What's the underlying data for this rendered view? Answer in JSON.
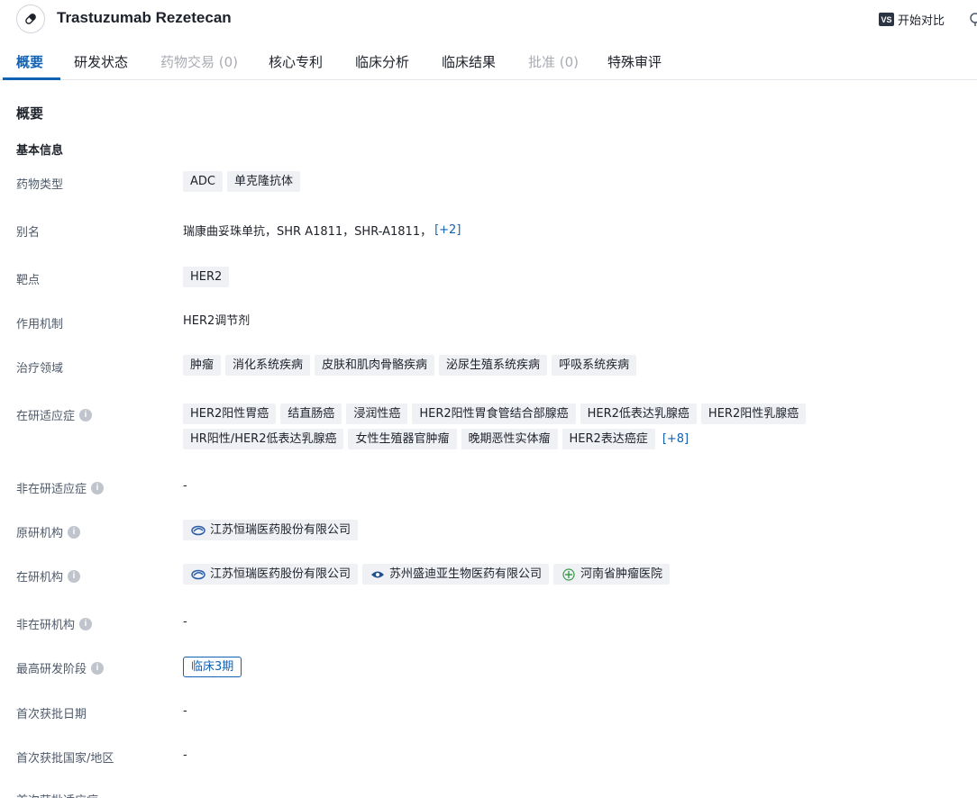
{
  "header": {
    "drug_name": "Trastuzumab Rezetecan",
    "drug_icon": "pill-icon",
    "compare_badge": "VS",
    "compare_label": "开始对比"
  },
  "tabs": [
    {
      "label": "概要",
      "state": "active"
    },
    {
      "label": "研发状态",
      "state": "normal"
    },
    {
      "label": "药物交易 (0)",
      "state": "disabled"
    },
    {
      "label": "核心专利",
      "state": "normal"
    },
    {
      "label": "临床分析",
      "state": "normal"
    },
    {
      "label": "临床结果",
      "state": "normal"
    },
    {
      "label": "批准 (0)",
      "state": "disabled"
    },
    {
      "label": "特殊审评",
      "state": "normal"
    }
  ],
  "overview": {
    "section_title": "概要",
    "basic_info_title": "基本信息"
  },
  "fields": {
    "drug_type": {
      "label": "药物类型",
      "tags": [
        "ADC",
        "单克隆抗体"
      ]
    },
    "alias": {
      "label": "别名",
      "text": "瑞康曲妥珠单抗，SHR A1811，SHR-A1811，",
      "more": "[+2]"
    },
    "target": {
      "label": "靶点",
      "tags": [
        "HER2"
      ]
    },
    "mechanism": {
      "label": "作用机制",
      "text": "HER2调节剂"
    },
    "therapeutic_area": {
      "label": "治疗领域",
      "tags": [
        "肿瘤",
        "消化系统疾病",
        "皮肤和肌肉骨骼疾病",
        "泌尿生殖系统疾病",
        "呼吸系统疾病"
      ]
    },
    "active_indication": {
      "label": "在研适应症",
      "info": "i",
      "tags": [
        "HER2阳性胃癌",
        "结直肠癌",
        "浸润性癌",
        "HER2阳性胃食管结合部腺癌",
        "HER2低表达乳腺癌",
        "HER2阳性乳腺癌",
        "HR阳性/HER2低表达乳腺癌",
        "女性生殖器官肿瘤",
        "晚期恶性实体瘤",
        "HER2表达癌症"
      ],
      "more": "[+8]"
    },
    "inactive_indication": {
      "label": "非在研适应症",
      "info": "i",
      "text": "-"
    },
    "originator": {
      "label": "原研机构",
      "info": "i",
      "orgs": [
        "江苏恒瑞医药股份有限公司"
      ]
    },
    "active_org": {
      "label": "在研机构",
      "info": "i",
      "orgs": [
        "江苏恒瑞医药股份有限公司",
        "苏州盛迪亚生物医药有限公司",
        "河南省肿瘤医院"
      ]
    },
    "inactive_org": {
      "label": "非在研机构",
      "info": "i",
      "text": "-"
    },
    "highest_phase": {
      "label": "最高研发阶段",
      "info": "i",
      "tag": "临床3期"
    },
    "first_approval_date": {
      "label": "首次获批日期",
      "text": "-"
    },
    "first_approval_country": {
      "label": "首次获批国家/地区",
      "text": "-"
    },
    "first_approval_indication": {
      "label": "首次获批适应症"
    }
  },
  "colors": {
    "accent": "#1262b3",
    "tag_bg": "#f0f1f5",
    "label_text": "#4e5969",
    "disabled_text": "#a8abb2"
  }
}
